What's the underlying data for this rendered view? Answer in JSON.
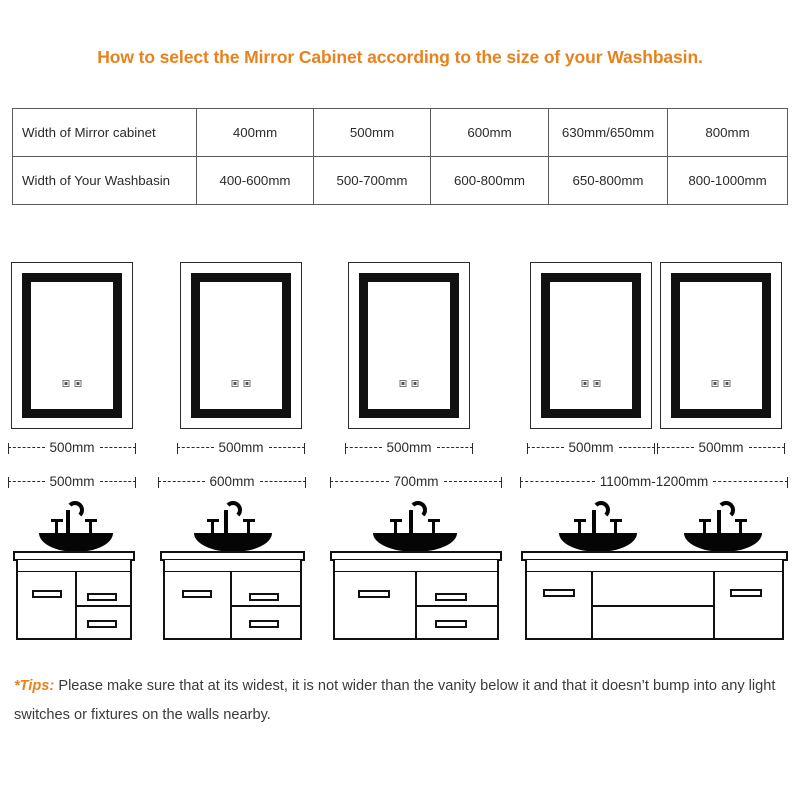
{
  "title": "How to select the Mirror Cabinet according to the size of your Washbasin.",
  "table": {
    "rows": [
      {
        "header": "Width of Mirror cabinet",
        "cells": [
          "400mm",
          "500mm",
          "600mm",
          "630mm/650mm",
          "800mm"
        ]
      },
      {
        "header": "Width of Your Washbasin",
        "cells": [
          "400-600mm",
          "500-700mm",
          "600-800mm",
          "650-800mm",
          "800-1000mm"
        ]
      }
    ]
  },
  "mirrors": [
    {
      "label": "500mm"
    },
    {
      "label": "500mm"
    },
    {
      "label": "500mm"
    },
    {
      "label": "500mm"
    },
    {
      "label": "500mm"
    }
  ],
  "vanities": [
    {
      "label": "500mm"
    },
    {
      "label": "600mm"
    },
    {
      "label": "700mm"
    },
    {
      "label": "1100mm-1200mm"
    }
  ],
  "tips": {
    "keyword": "*Tips:",
    "text": " Please make sure that at its widest, it is not wider than the vanity below it and that it doesn’t bump into any light switches or fixtures on the walls nearby."
  },
  "colors": {
    "accent": "#E8821E",
    "ink": "#2b2b2b",
    "fixture": "#050505",
    "background": "#ffffff"
  }
}
